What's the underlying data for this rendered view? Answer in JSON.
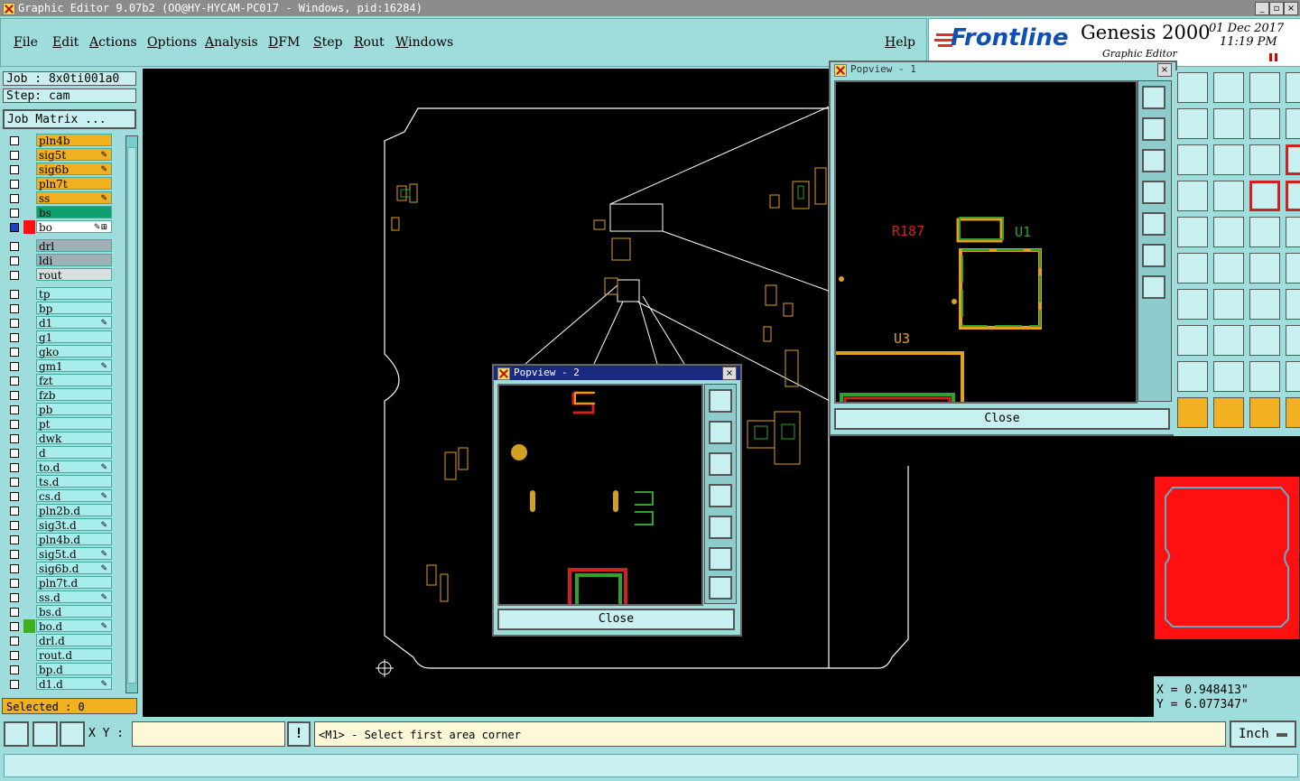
{
  "window": {
    "title": "Graphic Editor 9.07b2 (OO@HY-HYCAM-PC017 - Windows, pid:16284)"
  },
  "menu": [
    "File",
    "Edit",
    "Actions",
    "Options",
    "Analysis",
    "DFM",
    "Step",
    "Rout",
    "Windows"
  ],
  "help": "Help",
  "brand": {
    "logo": "Frontline",
    "product": "Genesis 2000",
    "subtitle": "Graphic Editor",
    "date": "01 Dec 2017",
    "time": "11:19 PM"
  },
  "job": {
    "job": "Job : 8x0ti001a0",
    "step": "Step: cam",
    "matrix": "Job Matrix ..."
  },
  "colors": {
    "orange": "#f0b020",
    "green": "#10a070",
    "gray": "#a0b0b8",
    "cyan": "#9fdcdc",
    "board": "#ff1010"
  },
  "layers": [
    {
      "name": "pln4b",
      "fill": "orange",
      "mark": ""
    },
    {
      "name": "sig5t",
      "fill": "orange",
      "mark": "✎"
    },
    {
      "name": "sig6b",
      "fill": "orange",
      "mark": "✎"
    },
    {
      "name": "pln7t",
      "fill": "orange",
      "mark": ""
    },
    {
      "name": "ss",
      "fill": "orange",
      "mark": "✎"
    },
    {
      "name": "bs",
      "fill": "green",
      "mark": ""
    },
    {
      "name": "bo",
      "fill": "white",
      "mark": "✎⊞",
      "active": true
    },
    {
      "name": "drl",
      "fill": "gray",
      "mark": ""
    },
    {
      "name": "ldi",
      "fill": "gray",
      "mark": ""
    },
    {
      "name": "rout",
      "fill": "light",
      "mark": ""
    },
    {
      "name": "tp",
      "fill": "cyan",
      "mark": ""
    },
    {
      "name": "bp",
      "fill": "cyan",
      "mark": ""
    },
    {
      "name": "d1",
      "fill": "cyan",
      "mark": "✎"
    },
    {
      "name": "g1",
      "fill": "cyan",
      "mark": ""
    },
    {
      "name": "gko",
      "fill": "cyan",
      "mark": ""
    },
    {
      "name": "gm1",
      "fill": "cyan",
      "mark": "✎"
    },
    {
      "name": "fzt",
      "fill": "cyan",
      "mark": ""
    },
    {
      "name": "fzb",
      "fill": "cyan",
      "mark": ""
    },
    {
      "name": "pb",
      "fill": "cyan",
      "mark": ""
    },
    {
      "name": "pt",
      "fill": "cyan",
      "mark": ""
    },
    {
      "name": "dwk",
      "fill": "cyan",
      "mark": ""
    },
    {
      "name": "d",
      "fill": "cyan",
      "mark": ""
    },
    {
      "name": "to.d",
      "fill": "cyan",
      "mark": "✎"
    },
    {
      "name": "ts.d",
      "fill": "cyan",
      "mark": ""
    },
    {
      "name": "cs.d",
      "fill": "cyan",
      "mark": "✎"
    },
    {
      "name": "pln2b.d",
      "fill": "cyan",
      "mark": ""
    },
    {
      "name": "sig3t.d",
      "fill": "cyan",
      "mark": "✎"
    },
    {
      "name": "pln4b.d",
      "fill": "cyan",
      "mark": ""
    },
    {
      "name": "sig5t.d",
      "fill": "cyan",
      "mark": "✎"
    },
    {
      "name": "sig6b.d",
      "fill": "cyan",
      "mark": "✎"
    },
    {
      "name": "pln7t.d",
      "fill": "cyan",
      "mark": ""
    },
    {
      "name": "ss.d",
      "fill": "cyan",
      "mark": "✎"
    },
    {
      "name": "bs.d",
      "fill": "cyan",
      "mark": ""
    },
    {
      "name": "bo.d",
      "fill": "cyan",
      "mark": "✎",
      "swatch": "green"
    },
    {
      "name": "drl.d",
      "fill": "cyan",
      "mark": ""
    },
    {
      "name": "rout.d",
      "fill": "cyan",
      "mark": ""
    },
    {
      "name": "bp.d",
      "fill": "cyan",
      "mark": ""
    },
    {
      "name": "d1.d",
      "fill": "cyan",
      "mark": "✎"
    }
  ],
  "selected": "Selected : 0",
  "coords": {
    "x": "X = 0.948413\"",
    "y": "Y = 6.077347\""
  },
  "status": {
    "xy_label": "X Y :",
    "message": "<M1> - Select first area corner",
    "units": "Inch"
  },
  "popview1": {
    "title": "Popview - 1",
    "close": "Close",
    "labels": {
      "r": "R187",
      "u1": "U1",
      "u3": "U3"
    }
  },
  "popview2": {
    "title": "Popview - 2",
    "close": "Close"
  }
}
